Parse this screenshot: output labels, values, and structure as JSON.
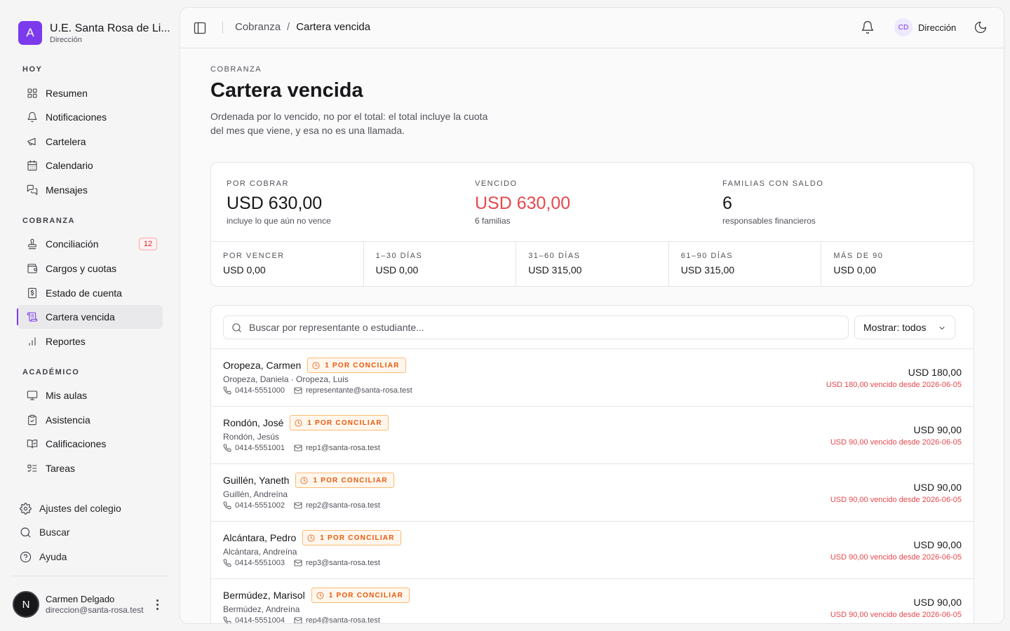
{
  "brand": {
    "logo_letter": "A",
    "name": "U.E. Santa Rosa de Li...",
    "role": "Dirección",
    "accent": "#7c3aed"
  },
  "sidebar": {
    "sections": [
      {
        "label": "HOY"
      },
      {
        "label": "COBRANZA"
      },
      {
        "label": "ACADÉMICO"
      }
    ],
    "items": [
      {
        "label": "Resumen",
        "icon": "grid-icon"
      },
      {
        "label": "Notificaciones",
        "icon": "bell-icon"
      },
      {
        "label": "Cartelera",
        "icon": "megaphone-icon"
      },
      {
        "label": "Calendario",
        "icon": "calendar-icon"
      },
      {
        "label": "Mensajes",
        "icon": "messages-icon"
      },
      {
        "label": "Conciliación",
        "icon": "stamp-icon",
        "badge": "12"
      },
      {
        "label": "Cargos y cuotas",
        "icon": "wallet-icon"
      },
      {
        "label": "Estado de cuenta",
        "icon": "receipt-icon"
      },
      {
        "label": "Cartera vencida",
        "icon": "scroll-icon",
        "active": true
      },
      {
        "label": "Reportes",
        "icon": "bar-chart-icon"
      },
      {
        "label": "Mis aulas",
        "icon": "presentation-icon"
      },
      {
        "label": "Asistencia",
        "icon": "clipboard-check-icon"
      },
      {
        "label": "Calificaciones",
        "icon": "book-check-icon"
      },
      {
        "label": "Tareas",
        "icon": "list-todo-icon"
      }
    ],
    "footer": [
      {
        "label": "Ajustes del colegio",
        "icon": "settings-icon"
      },
      {
        "label": "Buscar",
        "icon": "search-icon"
      },
      {
        "label": "Ayuda",
        "icon": "help-circle-icon"
      }
    ],
    "user": {
      "initial": "N",
      "name": "Carmen Delgado",
      "email": "direccion@santa-rosa.test"
    }
  },
  "topbar": {
    "breadcrumb": [
      "Cobranza",
      "Cartera vencida"
    ],
    "user_initials": "CD",
    "user_label": "Dirección"
  },
  "page": {
    "eyebrow": "COBRANZA",
    "title": "Cartera vencida",
    "description": "Ordenada por lo vencido, no por el total: el total incluye la cuota del mes que viene, y esa no es una llamada."
  },
  "summary": {
    "kpis": [
      {
        "label": "POR COBRAR",
        "value": "USD 630,00",
        "note": "incluye lo que aún no vence"
      },
      {
        "label": "VENCIDO",
        "value": "USD 630,00",
        "note": "6 familias",
        "color": "#e5484d"
      },
      {
        "label": "FAMILIAS CON SALDO",
        "value": "6",
        "note": "responsables financieros"
      }
    ],
    "aging": [
      {
        "label": "POR VENCER",
        "value": "USD 0,00"
      },
      {
        "label": "1–30 DÍAS",
        "value": "USD 0,00"
      },
      {
        "label": "31–60 DÍAS",
        "value": "USD 315,00"
      },
      {
        "label": "61–90 DÍAS",
        "value": "USD 315,00"
      },
      {
        "label": "MÁS DE 90",
        "value": "USD 0,00"
      }
    ]
  },
  "filters": {
    "search_placeholder": "Buscar por representante o estudiante...",
    "show_value": "Mostrar: todos"
  },
  "accounts": [
    {
      "name": "Oropeza, Carmen",
      "badge": "1 POR CONCILIAR",
      "students": "Oropeza, Daniela · Oropeza, Luis",
      "phone": "0414-5551000",
      "email": "representante@santa-rosa.test",
      "amount": "USD 180,00",
      "overdue": "USD 180,00 vencido desde 2026-06-05"
    },
    {
      "name": "Rondón, José",
      "badge": "1 POR CONCILIAR",
      "students": "Rondón, Jesús",
      "phone": "0414-5551001",
      "email": "rep1@santa-rosa.test",
      "amount": "USD 90,00",
      "overdue": "USD 90,00 vencido desde 2026-06-05"
    },
    {
      "name": "Guillén, Yaneth",
      "badge": "1 POR CONCILIAR",
      "students": "Guillén, Andreína",
      "phone": "0414-5551002",
      "email": "rep2@santa-rosa.test",
      "amount": "USD 90,00",
      "overdue": "USD 90,00 vencido desde 2026-06-05"
    },
    {
      "name": "Alcántara, Pedro",
      "badge": "1 POR CONCILIAR",
      "students": "Alcántara, Andreína",
      "phone": "0414-5551003",
      "email": "rep3@santa-rosa.test",
      "amount": "USD 90,00",
      "overdue": "USD 90,00 vencido desde 2026-06-05"
    },
    {
      "name": "Bermúdez, Marisol",
      "badge": "1 POR CONCILIAR",
      "students": "Bermúdez, Andreína",
      "phone": "0414-5551004",
      "email": "rep4@santa-rosa.test",
      "amount": "USD 90,00",
      "overdue": "USD 90,00 vencido desde 2026-06-05"
    }
  ]
}
